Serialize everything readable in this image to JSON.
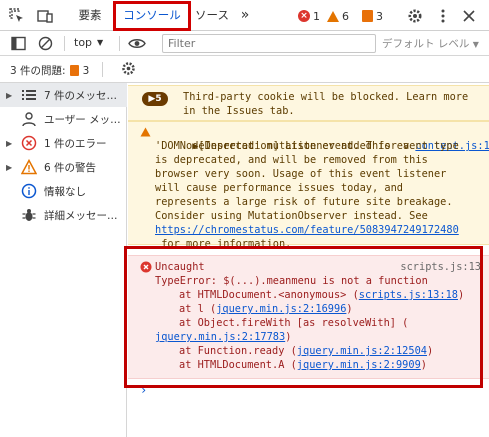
{
  "tabs": {
    "elements": "要素",
    "console": "コンソール",
    "sources": "ソース",
    "more": "»"
  },
  "counters": {
    "errors": "1",
    "warnings": "6",
    "issues": "3"
  },
  "toolbar": {
    "context": "top",
    "filter_placeholder": "Filter",
    "level": "デフォルト レベル"
  },
  "issues_bar": {
    "label": "3 件の問題:",
    "count": "3"
  },
  "sidebar": {
    "items": [
      {
        "label": "7 件のメッセ…",
        "icon": "list-icon",
        "expanded": true
      },
      {
        "label": "ユーザー メッ…",
        "icon": "user-icon"
      },
      {
        "label": "1 件のエラー",
        "icon": "error-icon"
      },
      {
        "label": "6 件の警告",
        "icon": "warning-icon"
      },
      {
        "label": "情報なし",
        "icon": "info-icon"
      },
      {
        "label": "詳細メッセー…",
        "icon": "bug-icon"
      }
    ]
  },
  "messages": {
    "cookie": {
      "badge": "5",
      "line1": "Third-party cookie will be blocked. Learn more",
      "line2": "in the Issues tab."
    },
    "deprecation": {
      "prefix": "▶[Deprecation] Listener added for a ",
      "source": "content.js:1",
      "lines": [
        "'DOMNodeInserted' mutation event. This event type",
        "is deprecated, and will be removed from this",
        "browser very soon. Usage of this event listener",
        "will cause performance issues today, and",
        "represents a large risk of future site breakage.",
        "Consider using MutationObserver instead. See"
      ],
      "url": "https://chromestatus.com/feature/5083947249172480",
      "suffix": " for more information."
    },
    "error": {
      "title": "Uncaught",
      "source": "scripts.js:13",
      "message": "TypeError: $(...).meanmenu is not a function",
      "stack": [
        {
          "pre": "at HTMLDocument.<anonymous> (",
          "link": "scripts.js:13:18",
          "post": ")"
        },
        {
          "pre": "at l (",
          "link": "jquery.min.js:2:16996",
          "post": ")"
        },
        {
          "pre": "at Object.fireWith [as resolveWith] (",
          "link": "",
          "post": ""
        },
        {
          "pre": "",
          "link": "jquery.min.js:2:17783",
          "post": ")"
        },
        {
          "pre": "at Function.ready (",
          "link": "jquery.min.js:2:12504",
          "post": ")"
        },
        {
          "pre": "at HTMLDocument.A (",
          "link": "jquery.min.js:2:9909",
          "post": ")"
        }
      ]
    }
  },
  "prompt": "›"
}
